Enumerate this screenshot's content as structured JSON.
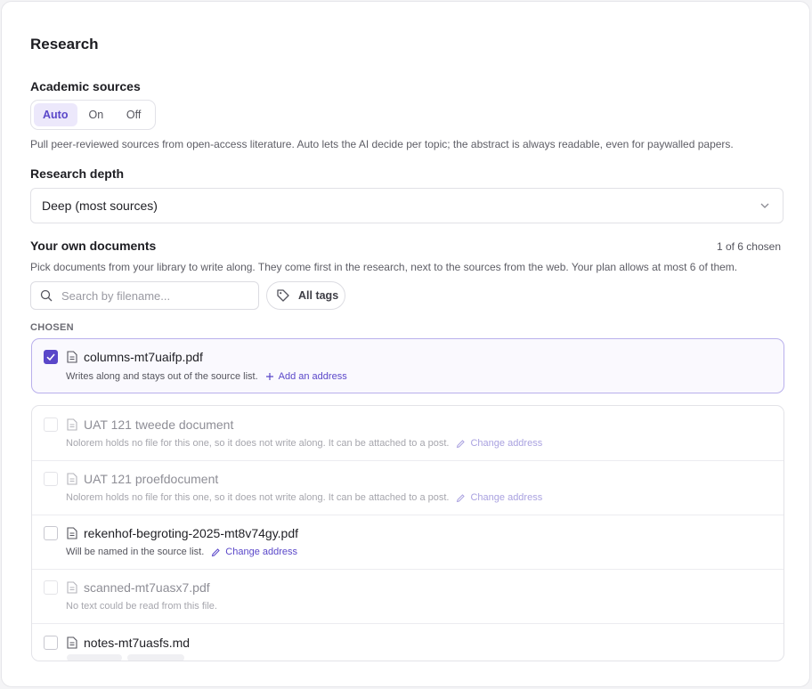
{
  "page": {
    "title": "Research"
  },
  "academic": {
    "label": "Academic sources",
    "options": [
      "Auto",
      "On",
      "Off"
    ],
    "selected": "Auto",
    "help": "Pull peer-reviewed sources from open-access literature. Auto lets the AI decide per topic; the abstract is always readable, even for paywalled papers."
  },
  "depth": {
    "label": "Research depth",
    "value": "Deep (most sources)"
  },
  "docs": {
    "label": "Your own documents",
    "count": "1 of 6 chosen",
    "help": "Pick documents from your library to write along. They come first in the research, next to the sources from the web. Your plan allows at most 6 of them.",
    "search_placeholder": "Search by filename...",
    "tags_label": "All tags",
    "chosen_heading": "CHOSEN",
    "chosen": {
      "name": "columns-mt7uaifp.pdf",
      "note": "Writes along and stays out of the source list.",
      "action": "Add an address"
    },
    "items": [
      {
        "name": "UAT 121 tweede document",
        "note": "Nolorem holds no file for this one, so it does not write along. It can be attached to a post.",
        "action": "Change address",
        "disabled": true
      },
      {
        "name": "UAT 121 proefdocument",
        "note": "Nolorem holds no file for this one, so it does not write along. It can be attached to a post.",
        "action": "Change address",
        "disabled": true
      },
      {
        "name": "rekenhof-begroting-2025-mt8v74gy.pdf",
        "note": "Will be named in the source list.",
        "action": "Change address",
        "disabled": false
      },
      {
        "name": "scanned-mt7uasx7.pdf",
        "note": "No text could be read from this file.",
        "action": "",
        "disabled": true
      },
      {
        "name": "notes-mt7uasfs.md",
        "note": "",
        "action": "",
        "disabled": false
      }
    ]
  },
  "colors": {
    "accent": "#5a47c9",
    "accent_bg": "#ece8fb",
    "chosen_border": "#b9b0ec"
  }
}
